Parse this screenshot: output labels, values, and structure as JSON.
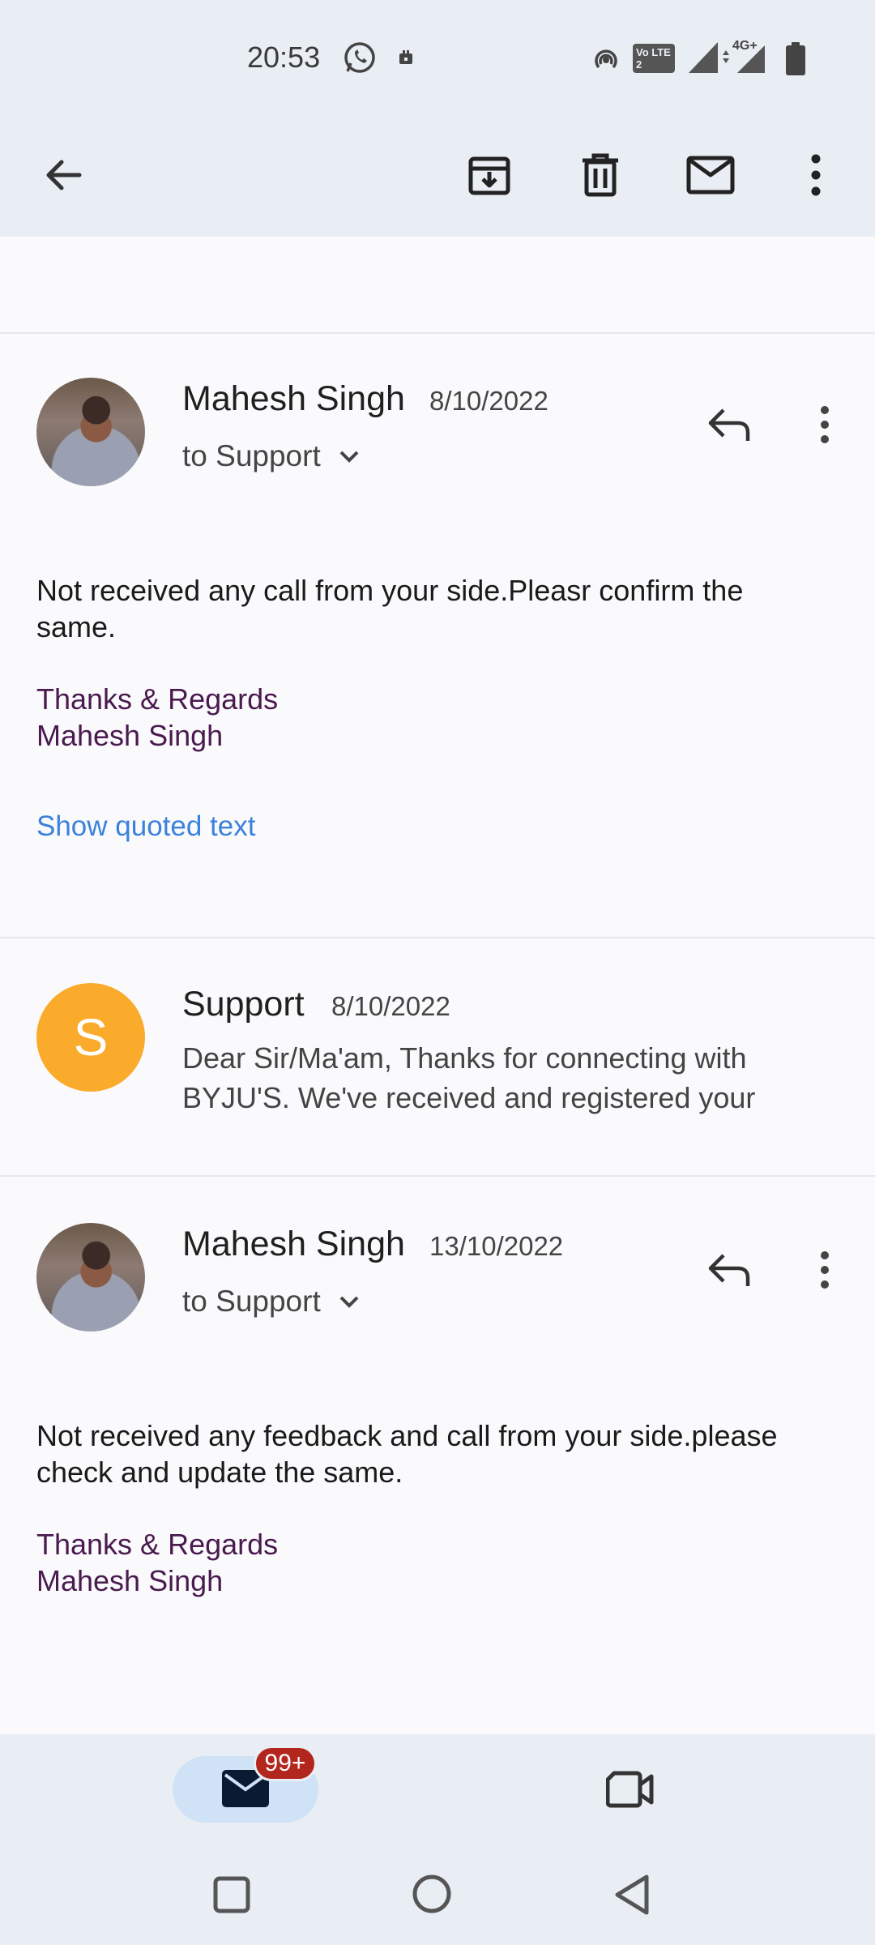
{
  "status_bar": {
    "time": "20:53",
    "icons": [
      "whatsapp-icon",
      "notification-icon",
      "hotspot-icon",
      "volte-icon",
      "signal-icon",
      "signal-4g-icon",
      "battery-icon"
    ],
    "volte_label": "Vo LTE 2",
    "network_label": "4G+"
  },
  "app_bar": {
    "icons": [
      "back-arrow-icon",
      "archive-icon",
      "delete-icon",
      "mark-unread-icon",
      "more-vert-icon"
    ]
  },
  "thread": [
    {
      "sender": "Mahesh Singh",
      "date": "8/10/2022",
      "recipient": "to Support",
      "body": "Not received any call from your side.Pleasr confirm the same.",
      "signature_line1": "Thanks & Regards",
      "signature_line2": "Mahesh Singh",
      "show_quoted": "Show quoted text"
    },
    {
      "sender": "Support",
      "avatar_letter": "S",
      "date": "8/10/2022",
      "snippet": "Dear Sir/Ma'am, Thanks for connecting with BYJU'S. We've received and registered your"
    },
    {
      "sender": "Mahesh Singh",
      "date": "13/10/2022",
      "recipient": "to Support",
      "body": "Not received any feedback and call from your side.please check and update the same.",
      "signature_line1": "Thanks & Regards",
      "signature_line2": "Mahesh Singh"
    }
  ],
  "bottom_nav": {
    "mail_badge": "99+",
    "icons": [
      "mail-icon",
      "video-camera-icon"
    ]
  },
  "colors": {
    "bar_bg": "#e9edf4",
    "content_bg": "#fafafd",
    "signature": "#4a1a4f",
    "link": "#3b82dc",
    "support_avatar": "#fbab2b",
    "badge": "#b3261e",
    "mail_pill": "#cfe2f6"
  }
}
